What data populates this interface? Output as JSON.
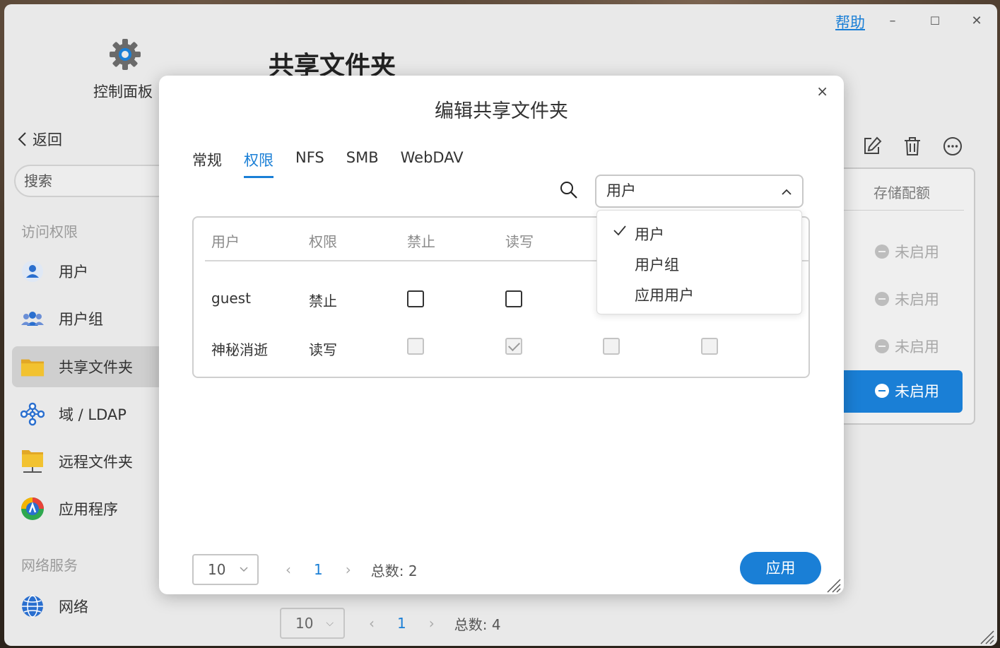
{
  "window": {
    "help_label": "帮助",
    "minimize": "–",
    "maximize": "☐",
    "close": "✕"
  },
  "sidebar": {
    "app_name": "控制面板",
    "back_label": "返回",
    "search_placeholder": "搜索",
    "sections": [
      {
        "title": "访问权限"
      },
      {
        "title": "网络服务"
      }
    ],
    "items": [
      {
        "label": "用户",
        "icon": "user-icon"
      },
      {
        "label": "用户组",
        "icon": "user-group-icon"
      },
      {
        "label": "共享文件夹",
        "icon": "folder-icon"
      },
      {
        "label": "域 / LDAP",
        "icon": "network-tree-icon"
      },
      {
        "label": "远程文件夹",
        "icon": "remote-folder-icon"
      },
      {
        "label": "应用程序",
        "icon": "app-store-icon"
      },
      {
        "label": "网络",
        "icon": "globe-icon"
      }
    ]
  },
  "main": {
    "page_title": "共享文件夹",
    "quota_header": "存储配额",
    "status_rows": [
      "未启用",
      "未启用",
      "未启用",
      "未启用"
    ],
    "pager": {
      "page_size": "10",
      "current_page": "1",
      "total": "总数: 4"
    }
  },
  "modal": {
    "title": "编辑共享文件夹",
    "close": "×",
    "tabs": [
      {
        "label": "常规",
        "active": false
      },
      {
        "label": "权限",
        "active": true
      },
      {
        "label": "NFS",
        "active": false
      },
      {
        "label": "SMB",
        "active": false
      },
      {
        "label": "WebDAV",
        "active": false
      }
    ],
    "type_select": {
      "value": "用户",
      "options": [
        "用户",
        "用户组",
        "应用用户"
      ],
      "selected_index": 0
    },
    "table": {
      "headers": [
        "用户",
        "权限",
        "禁止",
        "读写"
      ],
      "rows": [
        {
          "user": "guest",
          "permission": "禁止",
          "checks": [
            false,
            false
          ]
        },
        {
          "user": "神秘消逝",
          "permission": "读写",
          "checks": [
            false,
            true,
            false,
            false
          ]
        }
      ]
    },
    "pager": {
      "page_size": "10",
      "current_page": "1",
      "total": "总数: 2"
    },
    "apply_label": "应用"
  },
  "colors": {
    "accent": "#1a7fd6",
    "window_bg": "#e9e9e9",
    "active_nav_bg": "#cfcfcf"
  }
}
